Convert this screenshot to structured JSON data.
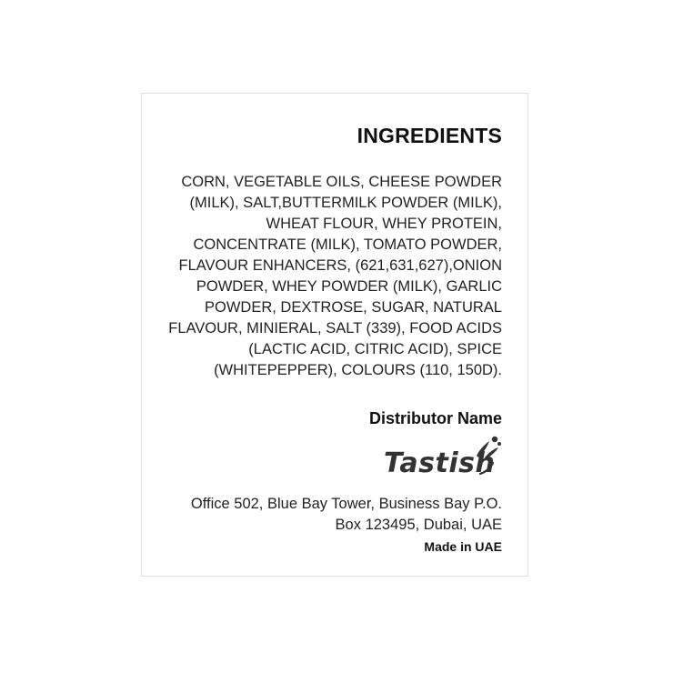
{
  "label": {
    "heading": "INGREDIENTS",
    "ingredients_lines": [
      "CORN, VEGETABLE OILS, CHEESE POWDER",
      "(MILK), SALT,BUTTERMILK POWDER (MILK),",
      "WHEAT FLOUR, WHEY PROTEIN,",
      "CONCENTRATE (MILK), TOMATO POWDER,",
      "FLAVOUR ENHANCERS, (621,631,627),ONION",
      "POWDER, WHEY POWDER (MILK), GARLIC",
      "POWDER, DEXTROSE, SUGAR, NATURAL",
      "FLAVOUR, MINIERAL, SALT (339), FOOD ACIDS",
      "(LACTIC ACID, CITRIC ACID), SPICE",
      "(WHITEPEPPER), COLOURS (110, 150D)."
    ],
    "distributor_heading": "Distributor Name",
    "logo": {
      "text": "Tastish",
      "icon": "splash-droplet-icon",
      "color": "#333333"
    },
    "address_lines": [
      "Office 502, Blue Bay Tower, Business Bay P.O.",
      "Box 123495, Dubai, UAE"
    ],
    "made_in": "Made in UAE"
  }
}
